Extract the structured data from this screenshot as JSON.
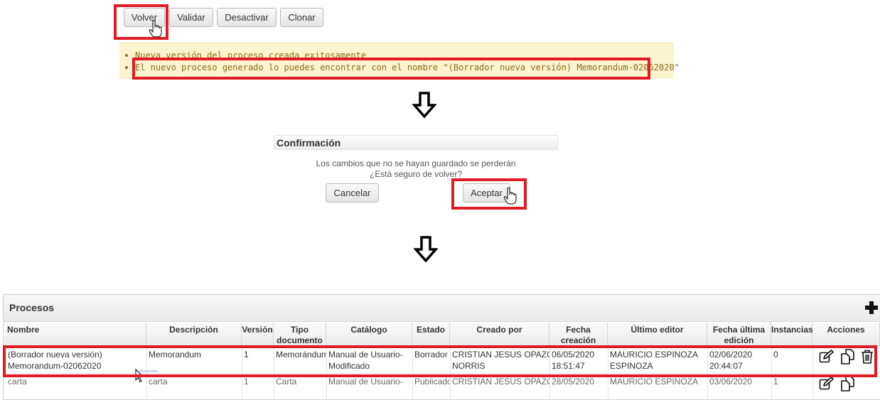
{
  "toolbar": {
    "volver": "Volver",
    "validar": "Validar",
    "desactivar": "Desactivar",
    "clonar": "Clonar"
  },
  "messages": [
    "Nueva versión del proceso creada exitosamente",
    "El nuevo proceso generado lo puedes encontrar con el nombre \"(Borrador nueva versión) Memorandum-02062020\""
  ],
  "dialog": {
    "title": "Confirmación",
    "line1": "Los cambios que no se hayan guardado se perderán",
    "line2": "¿Está seguro de volver?",
    "cancel": "Cancelar",
    "accept": "Aceptar"
  },
  "processes": {
    "title": "Procesos",
    "columns": {
      "nombre": "Nombre",
      "descripcion": "Descripción",
      "version": "Versión",
      "tipo1": "Tipo",
      "tipo2": "documento",
      "catalogo": "Catálogo",
      "estado": "Estado",
      "creado": "Creado por",
      "fecha1": "Fecha",
      "fecha2": "creación",
      "editor": "Último editor",
      "edicion1": "Fecha última",
      "edicion2": "edición",
      "instancias": "Instancias",
      "acciones": "Acciones"
    },
    "rows": [
      {
        "nombre1": "(Borrador nueva versión)",
        "nombre2": "Memorandum-02062020",
        "descripcion": "Memorandum",
        "version": "1",
        "tipo": "Memorándum",
        "catalogo1": "Manual de Usuario-",
        "catalogo2": "Modificado",
        "estado": "Borrador",
        "creado1": "CRISTIAN JESUS OPAZO",
        "creado2": "NORRIS",
        "fecha1": "06/05/2020",
        "fecha2": "18:51:47",
        "editor1": "MAURICIO ESPINOZA",
        "editor2": "ESPINOZA",
        "edicion1": "02/06/2020",
        "edicion2": "20:44:07",
        "instancias": "0"
      },
      {
        "nombre1": "carta",
        "descripcion": "carta",
        "version": "1",
        "tipo": "Carta",
        "catalogo1": "Manual de Usuario-",
        "estado": "Publicado",
        "creado1": "CRISTIAN JESUS OPAZO",
        "fecha1": "28/05/2020",
        "editor1": "MAURICIO ESPINOZA",
        "edicion1": "03/06/2020",
        "instancias": "1"
      }
    ]
  },
  "icons": {
    "edit": "edit-icon",
    "copy": "copy-icon",
    "delete": "trash-icon",
    "add": "plus-icon",
    "arrow": "arrow-down-icon",
    "pointer": "hand-cursor-icon"
  },
  "colors": {
    "highlight": "#e01b24",
    "message_bg": "#fcf4cf",
    "message_text": "#8a6d1a"
  }
}
